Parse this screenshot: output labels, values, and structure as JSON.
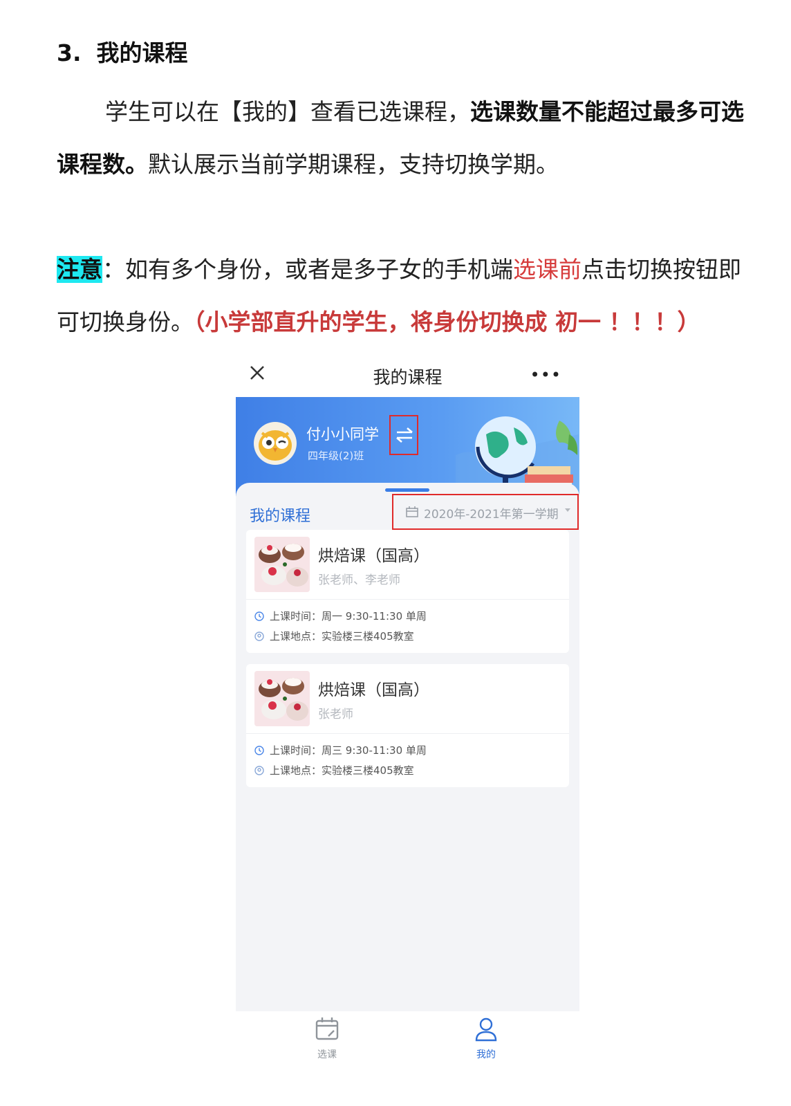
{
  "heading": {
    "number": "3.",
    "title": "我的课程"
  },
  "paragraph1": {
    "text1": "学生可以在【我的】查看已选课程，",
    "bold1": "选课数量不能超过最多可选",
    "bold2": "课程数。",
    "text2": "默认展示当前学期课程，支持切换学期。"
  },
  "paragraph2": {
    "highlight": "注意",
    "text1": "：如有多个身份，或者是多子女的手机端",
    "red1": "选课前",
    "text2": "点击切换按钮即",
    "text3": "可切换身份。",
    "red2": "（小学部直升的学生，将身份切换成  初一  ！！！）"
  },
  "phone": {
    "topbar": {
      "title": "我的课程",
      "more": "•••",
      "close_icon": "close-icon"
    },
    "profile": {
      "name": "付小小同学",
      "class": "四年级(2)班",
      "switch_icon": "swap-arrows-icon"
    },
    "section_title": "我的课程",
    "term_selector": "2020年-2021年第一学期",
    "courses": [
      {
        "name": "烘焙课（国高）",
        "teachers": "张老师、李老师",
        "time_label": "上课时间：",
        "time": "周一   9:30-11:30  单周",
        "place_label": "上课地点：",
        "place": "实验楼三楼405教室"
      },
      {
        "name": "烘焙课（国高）",
        "teachers": "张老师",
        "time_label": "上课时间：",
        "time": "周三   9:30-11:30  单周",
        "place_label": "上课地点：",
        "place": "实验楼三楼405教室"
      }
    ],
    "tabs": [
      {
        "label": "选课",
        "icon": "calendar-icon"
      },
      {
        "label": "我的",
        "icon": "user-icon"
      }
    ],
    "colors": {
      "accent": "#2f6fd6",
      "highlight_box": "#e02a2a"
    }
  }
}
